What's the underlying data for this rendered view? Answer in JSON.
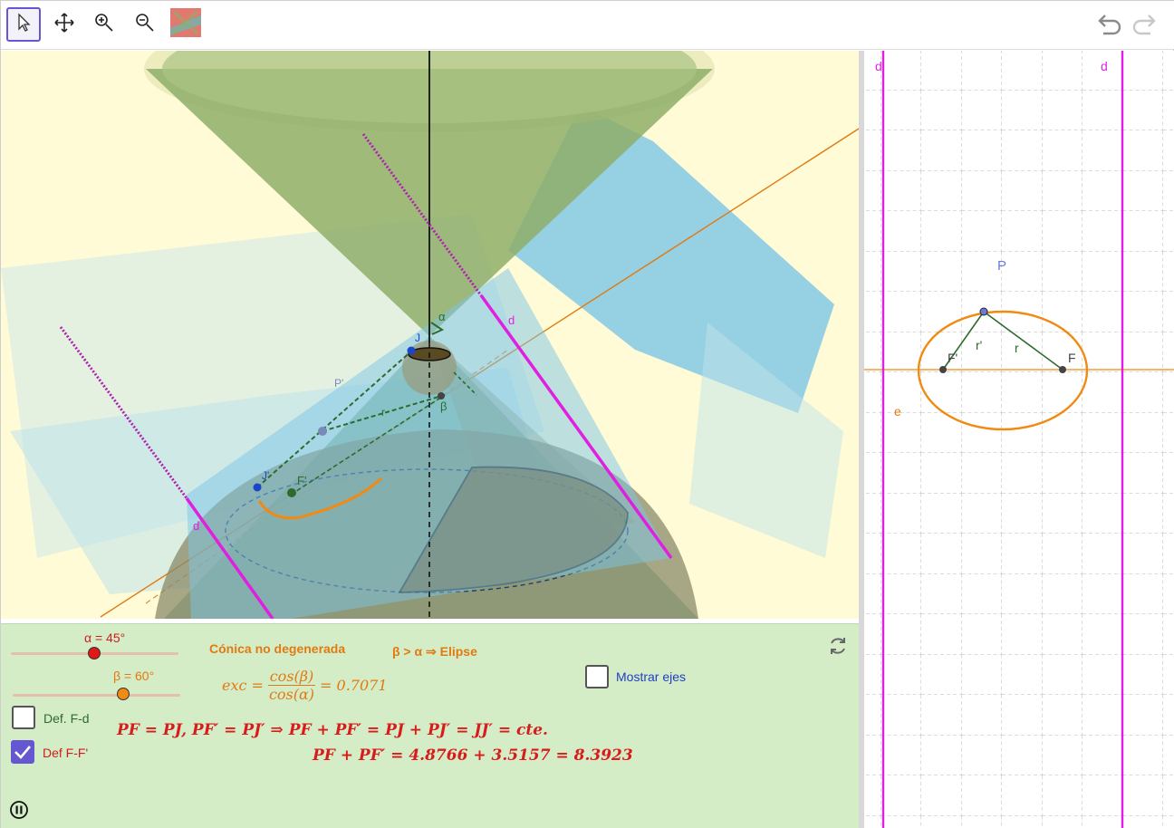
{
  "toolbar": {
    "tools": [
      {
        "name": "move-tool",
        "icon": "arrow-cursor-icon",
        "active": true
      },
      {
        "name": "move-graphics-view-tool",
        "icon": "move-cross-icon",
        "active": false
      },
      {
        "name": "zoom-in-tool",
        "icon": "zoom-in-icon",
        "active": false
      },
      {
        "name": "zoom-out-tool",
        "icon": "zoom-out-icon",
        "active": false
      },
      {
        "name": "custom-tool",
        "icon": "custom-image-icon",
        "active": false
      }
    ],
    "undo_icon": "undo-icon",
    "redo_icon": "redo-icon"
  },
  "view3d": {
    "labels": {
      "alpha": "α",
      "beta": "β",
      "j": "J",
      "j_prime": "J'",
      "f_prime": "F'",
      "p_prime": "P'",
      "r": "r",
      "d_left": "d",
      "d_right": "d"
    },
    "colors": {
      "background": "#fffbd6",
      "cone": "#8fae6a",
      "plane": "#7cc6e6",
      "directrix": "#e020e0",
      "axis_line": "#e07a12"
    }
  },
  "algebra": {
    "alpha_label": "α = 45°",
    "alpha_value": 45,
    "beta_label": "β = 60°",
    "beta_value": 60,
    "conic_type": "Cónica no degenerada",
    "conic_relation": "β > α ⇒ Elipse",
    "exc_formula_prefix": "exc =",
    "exc_numerator": "cos(β)",
    "exc_denominator": "cos(α)",
    "exc_value": "= 0.7071",
    "show_axes_label": "Mostrar ejes",
    "show_axes_checked": false,
    "def_fd_label": "Def. F-d",
    "def_fd_checked": false,
    "def_ff_label": "Def  F-F'",
    "def_ff_checked": true,
    "formula_line1": "PF = PJ, PF′ = PJ′ ⇒ PF + PF′ = PJ + PJ′ = JJ′ = cte.",
    "formula_line2": "PF + PF′ = 4.8766 + 3.5157 = 8.3923",
    "reset_icon": "refresh-icon",
    "pause_icon": "pause-icon"
  },
  "view2d": {
    "labels": {
      "d_left": "d",
      "d_right": "d",
      "e": "e",
      "p": "P",
      "f_prime": "F'",
      "f": "F",
      "r_prime": "r'",
      "r": "r"
    },
    "colors": {
      "ellipse": "#f08a12",
      "directrix": "#e020e0",
      "axis": "#f08a12",
      "radius": "#2d6b2d"
    }
  }
}
